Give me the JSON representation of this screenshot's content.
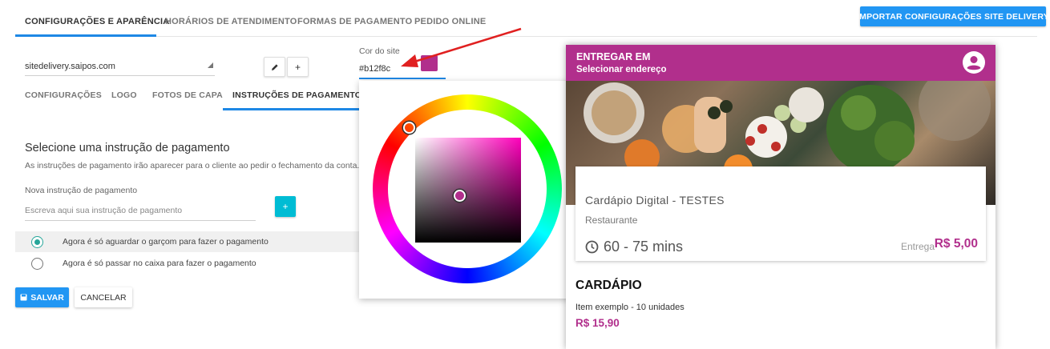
{
  "top_tabs": [
    "CONFIGURAÇÕES E APARÊNCIA",
    "HORÁRIOS DE ATENDIMENTO",
    "FORMAS DE PAGAMENTO",
    "PEDIDO ONLINE"
  ],
  "import_button": "IMPORTAR CONFIGURAÇÕES SITE DELIVERY",
  "site_select": {
    "value": "sitedelivery.saipos.com"
  },
  "color_field": {
    "label": "Cor do site",
    "value": "#b12f8c",
    "color": "#b12f8c"
  },
  "sub_tabs": [
    "CONFIGURAÇÕES",
    "LOGO",
    "FOTOS DE CAPA",
    "INSTRUÇÕES DE PAGAMENTO"
  ],
  "section": {
    "title": "Selecione uma instrução de pagamento",
    "description": "As instruções de pagamento irão aparecer para o cliente ao pedir o fechamento da conta."
  },
  "new_instruction": {
    "label": "Nova instrução de pagamento",
    "placeholder": "Escreva aqui sua instrução de pagamento",
    "add_icon": "+"
  },
  "options": [
    {
      "text": "Agora é só aguardar o garçom para fazer o pagamento",
      "selected": true
    },
    {
      "text": "Agora é só passar no caixa para fazer o pagamento",
      "selected": false
    }
  ],
  "buttons": {
    "save": "SALVAR",
    "cancel": "CANCELAR"
  },
  "preview": {
    "header_title": "ENTREGAR EM",
    "header_subtitle": "Selecionar endereço",
    "restaurant_name": "Cardápio Digital - TESTES",
    "restaurant_type": "Restaurante",
    "delivery_time": "60 - 75 mins",
    "delivery_label": "Entrega",
    "delivery_fee": "R$ 5,00",
    "menu_title": "CARDÁPIO",
    "item_name": "Item exemplo - 10 unidades",
    "item_price": "R$ 15,90"
  }
}
